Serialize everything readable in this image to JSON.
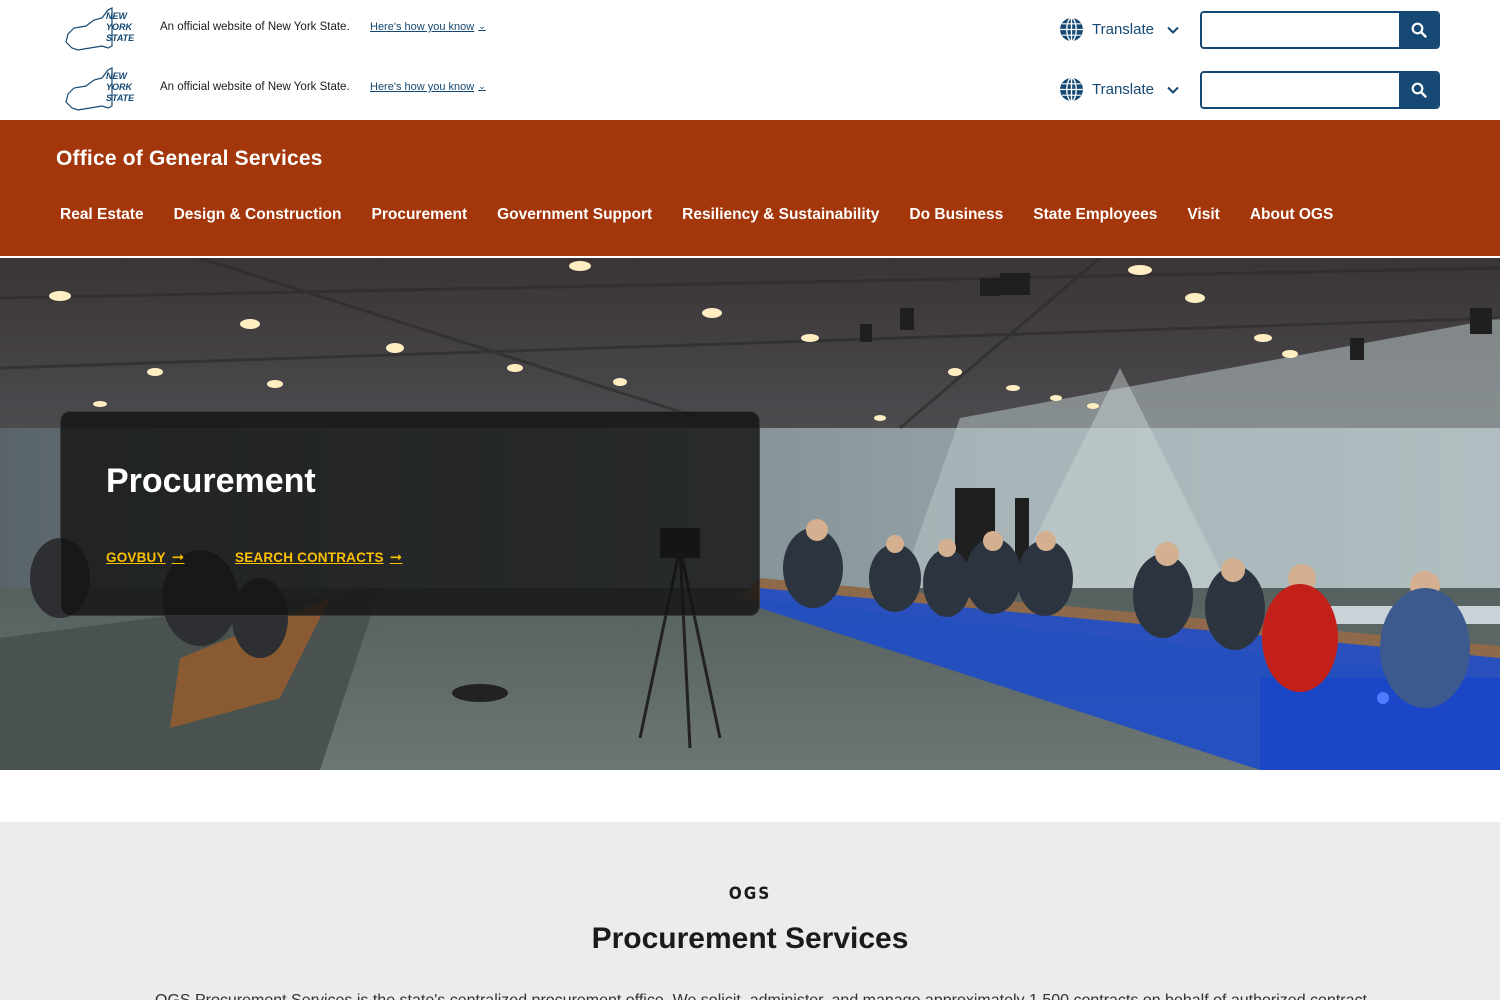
{
  "universal_header": {
    "logo_text": [
      "NEW",
      "YORK",
      "STATE"
    ],
    "official_text": "An official website of New York State.",
    "how_you_know": "Here's how you know",
    "translate_label": "Translate",
    "search_placeholder": ""
  },
  "agency": {
    "title": "Office of General Services"
  },
  "nav": {
    "items": [
      {
        "label": "Real Estate"
      },
      {
        "label": "Design & Construction"
      },
      {
        "label": "Procurement"
      },
      {
        "label": "Government Support"
      },
      {
        "label": "Resiliency & Sustainability"
      },
      {
        "label": "Do Business"
      },
      {
        "label": "State Employees"
      },
      {
        "label": "Visit"
      },
      {
        "label": "About OGS"
      }
    ]
  },
  "hero": {
    "title": "Procurement",
    "links": [
      {
        "label": "GOVBUY",
        "arrow": "➞"
      },
      {
        "label": "SEARCH CONTRACTS",
        "arrow": "➞"
      }
    ]
  },
  "intro": {
    "eyebrow": "OGS",
    "title": "Procurement Services",
    "text": "OGS Procurement Services is the state's centralized procurement office. We solicit, administer, and manage approximately 1,500 contracts on behalf of authorized contract"
  },
  "colors": {
    "ny_blue": "#154973",
    "agency_orange": "#a3360a",
    "link_gold": "#fcc000",
    "intro_gray": "#ececec"
  }
}
